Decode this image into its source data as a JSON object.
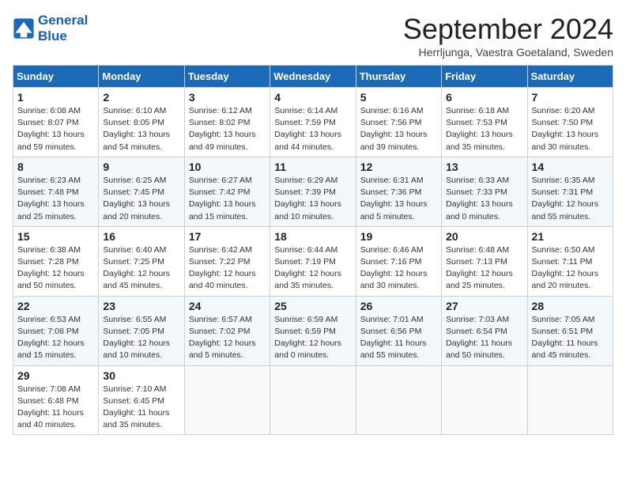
{
  "logo": {
    "line1": "General",
    "line2": "Blue"
  },
  "title": "September 2024",
  "subtitle": "Herrljunga, Vaestra Goetaland, Sweden",
  "days_of_week": [
    "Sunday",
    "Monday",
    "Tuesday",
    "Wednesday",
    "Thursday",
    "Friday",
    "Saturday"
  ],
  "weeks": [
    [
      {
        "day": "1",
        "sunrise": "6:08 AM",
        "sunset": "8:07 PM",
        "daylight": "13 hours and 59 minutes."
      },
      {
        "day": "2",
        "sunrise": "6:10 AM",
        "sunset": "8:05 PM",
        "daylight": "13 hours and 54 minutes."
      },
      {
        "day": "3",
        "sunrise": "6:12 AM",
        "sunset": "8:02 PM",
        "daylight": "13 hours and 49 minutes."
      },
      {
        "day": "4",
        "sunrise": "6:14 AM",
        "sunset": "7:59 PM",
        "daylight": "13 hours and 44 minutes."
      },
      {
        "day": "5",
        "sunrise": "6:16 AM",
        "sunset": "7:56 PM",
        "daylight": "13 hours and 39 minutes."
      },
      {
        "day": "6",
        "sunrise": "6:18 AM",
        "sunset": "7:53 PM",
        "daylight": "13 hours and 35 minutes."
      },
      {
        "day": "7",
        "sunrise": "6:20 AM",
        "sunset": "7:50 PM",
        "daylight": "13 hours and 30 minutes."
      }
    ],
    [
      {
        "day": "8",
        "sunrise": "6:23 AM",
        "sunset": "7:48 PM",
        "daylight": "13 hours and 25 minutes."
      },
      {
        "day": "9",
        "sunrise": "6:25 AM",
        "sunset": "7:45 PM",
        "daylight": "13 hours and 20 minutes."
      },
      {
        "day": "10",
        "sunrise": "6:27 AM",
        "sunset": "7:42 PM",
        "daylight": "13 hours and 15 minutes."
      },
      {
        "day": "11",
        "sunrise": "6:29 AM",
        "sunset": "7:39 PM",
        "daylight": "13 hours and 10 minutes."
      },
      {
        "day": "12",
        "sunrise": "6:31 AM",
        "sunset": "7:36 PM",
        "daylight": "13 hours and 5 minutes."
      },
      {
        "day": "13",
        "sunrise": "6:33 AM",
        "sunset": "7:33 PM",
        "daylight": "13 hours and 0 minutes."
      },
      {
        "day": "14",
        "sunrise": "6:35 AM",
        "sunset": "7:31 PM",
        "daylight": "12 hours and 55 minutes."
      }
    ],
    [
      {
        "day": "15",
        "sunrise": "6:38 AM",
        "sunset": "7:28 PM",
        "daylight": "12 hours and 50 minutes."
      },
      {
        "day": "16",
        "sunrise": "6:40 AM",
        "sunset": "7:25 PM",
        "daylight": "12 hours and 45 minutes."
      },
      {
        "day": "17",
        "sunrise": "6:42 AM",
        "sunset": "7:22 PM",
        "daylight": "12 hours and 40 minutes."
      },
      {
        "day": "18",
        "sunrise": "6:44 AM",
        "sunset": "7:19 PM",
        "daylight": "12 hours and 35 minutes."
      },
      {
        "day": "19",
        "sunrise": "6:46 AM",
        "sunset": "7:16 PM",
        "daylight": "12 hours and 30 minutes."
      },
      {
        "day": "20",
        "sunrise": "6:48 AM",
        "sunset": "7:13 PM",
        "daylight": "12 hours and 25 minutes."
      },
      {
        "day": "21",
        "sunrise": "6:50 AM",
        "sunset": "7:11 PM",
        "daylight": "12 hours and 20 minutes."
      }
    ],
    [
      {
        "day": "22",
        "sunrise": "6:53 AM",
        "sunset": "7:08 PM",
        "daylight": "12 hours and 15 minutes."
      },
      {
        "day": "23",
        "sunrise": "6:55 AM",
        "sunset": "7:05 PM",
        "daylight": "12 hours and 10 minutes."
      },
      {
        "day": "24",
        "sunrise": "6:57 AM",
        "sunset": "7:02 PM",
        "daylight": "12 hours and 5 minutes."
      },
      {
        "day": "25",
        "sunrise": "6:59 AM",
        "sunset": "6:59 PM",
        "daylight": "12 hours and 0 minutes."
      },
      {
        "day": "26",
        "sunrise": "7:01 AM",
        "sunset": "6:56 PM",
        "daylight": "11 hours and 55 minutes."
      },
      {
        "day": "27",
        "sunrise": "7:03 AM",
        "sunset": "6:54 PM",
        "daylight": "11 hours and 50 minutes."
      },
      {
        "day": "28",
        "sunrise": "7:05 AM",
        "sunset": "6:51 PM",
        "daylight": "11 hours and 45 minutes."
      }
    ],
    [
      {
        "day": "29",
        "sunrise": "7:08 AM",
        "sunset": "6:48 PM",
        "daylight": "11 hours and 40 minutes."
      },
      {
        "day": "30",
        "sunrise": "7:10 AM",
        "sunset": "6:45 PM",
        "daylight": "11 hours and 35 minutes."
      },
      null,
      null,
      null,
      null,
      null
    ]
  ]
}
